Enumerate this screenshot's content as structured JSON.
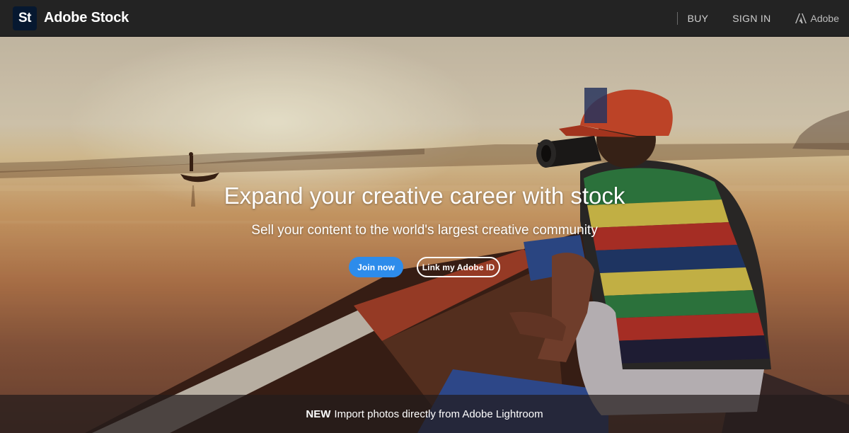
{
  "header": {
    "logo_mark": "St",
    "brand_name": "Adobe Stock",
    "buy_label": "BUY",
    "signin_label": "SIGN IN",
    "adobe_label": "Adobe",
    "adobe_icon": "adobe-logo-icon"
  },
  "hero": {
    "title": "Expand your creative career with stock",
    "subtitle": "Sell your content to the world's largest creative community",
    "join_label": "Join now",
    "link_label": "Link my Adobe ID"
  },
  "promo": {
    "badge": "NEW",
    "text": "Import photos directly from Adobe Lightroom"
  },
  "colors": {
    "nav_bg": "#232323",
    "logo_bg": "#061830",
    "primary_button": "#2d8ceb",
    "promo_bg": "rgba(35,28,28,0.72)"
  }
}
